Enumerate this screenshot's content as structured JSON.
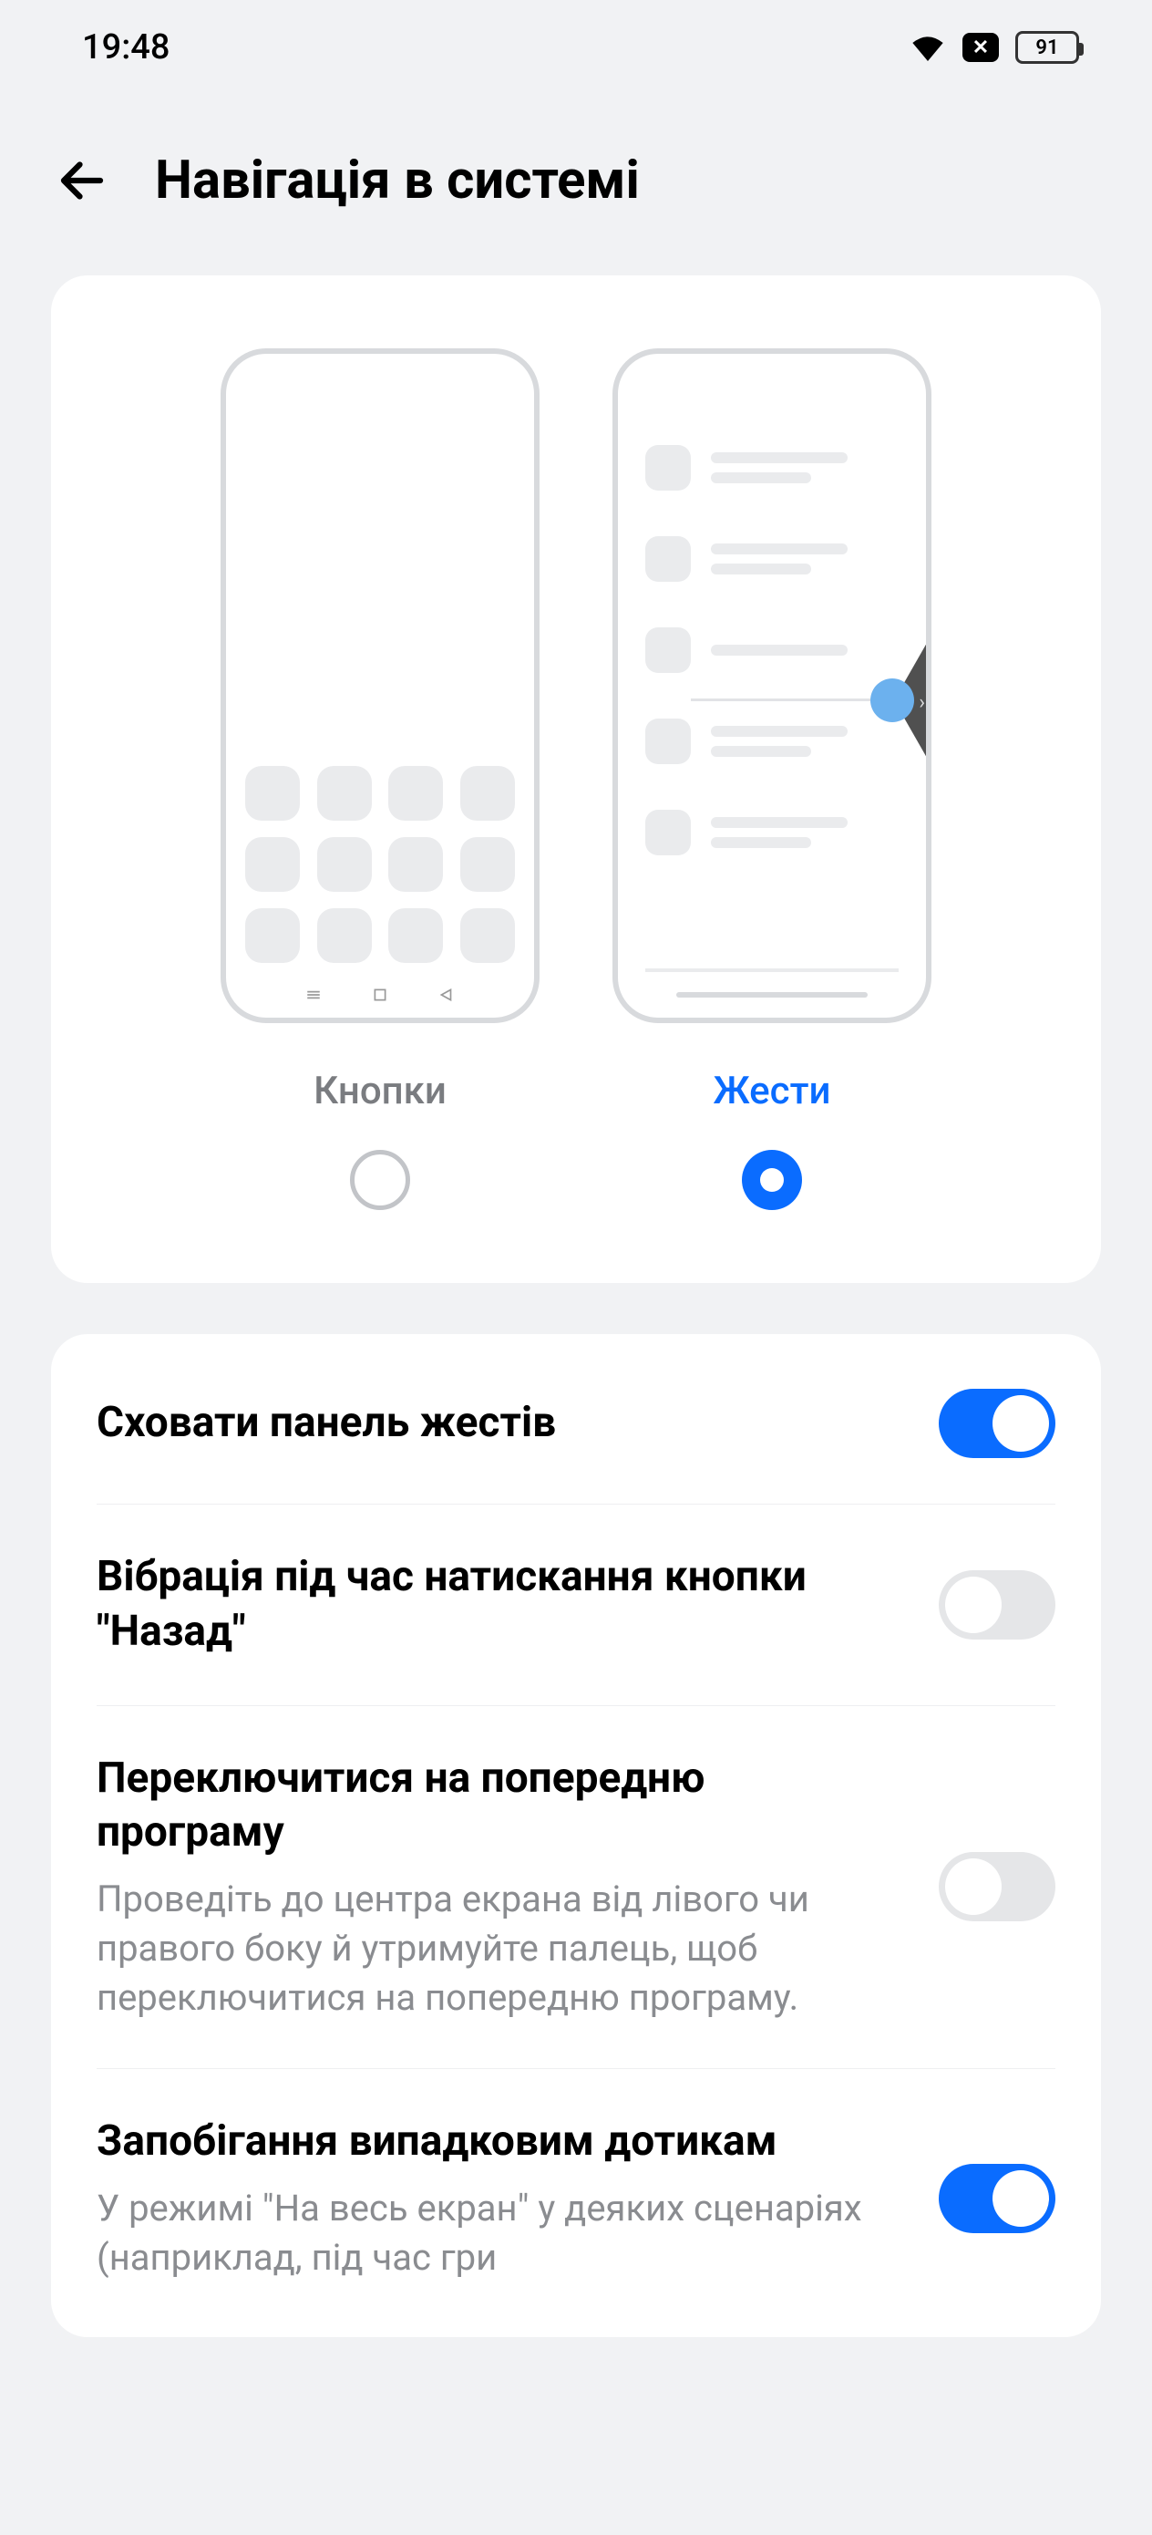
{
  "status": {
    "time": "19:48",
    "battery": "91"
  },
  "header": {
    "title": "Навігація в системі"
  },
  "modes": {
    "buttons_label": "Кнопки",
    "gestures_label": "Жести",
    "selected": "gestures"
  },
  "settings": [
    {
      "title": "Сховати панель жестів",
      "desc": "",
      "enabled": true
    },
    {
      "title": "Вібрація під час натискання кнопки \"Назад\"",
      "desc": "",
      "enabled": false
    },
    {
      "title": "Переключитися на попередню програму",
      "desc": "Проведіть до центра екрана від лівого чи правого боку й утримуйте палець, щоб переключитися на попередню програму.",
      "enabled": false
    },
    {
      "title": "Запобігання випадковим дотикам",
      "desc": "У режимі \"На весь екран\" у деяких сценаріях (наприклад, під час гри",
      "enabled": true
    }
  ]
}
